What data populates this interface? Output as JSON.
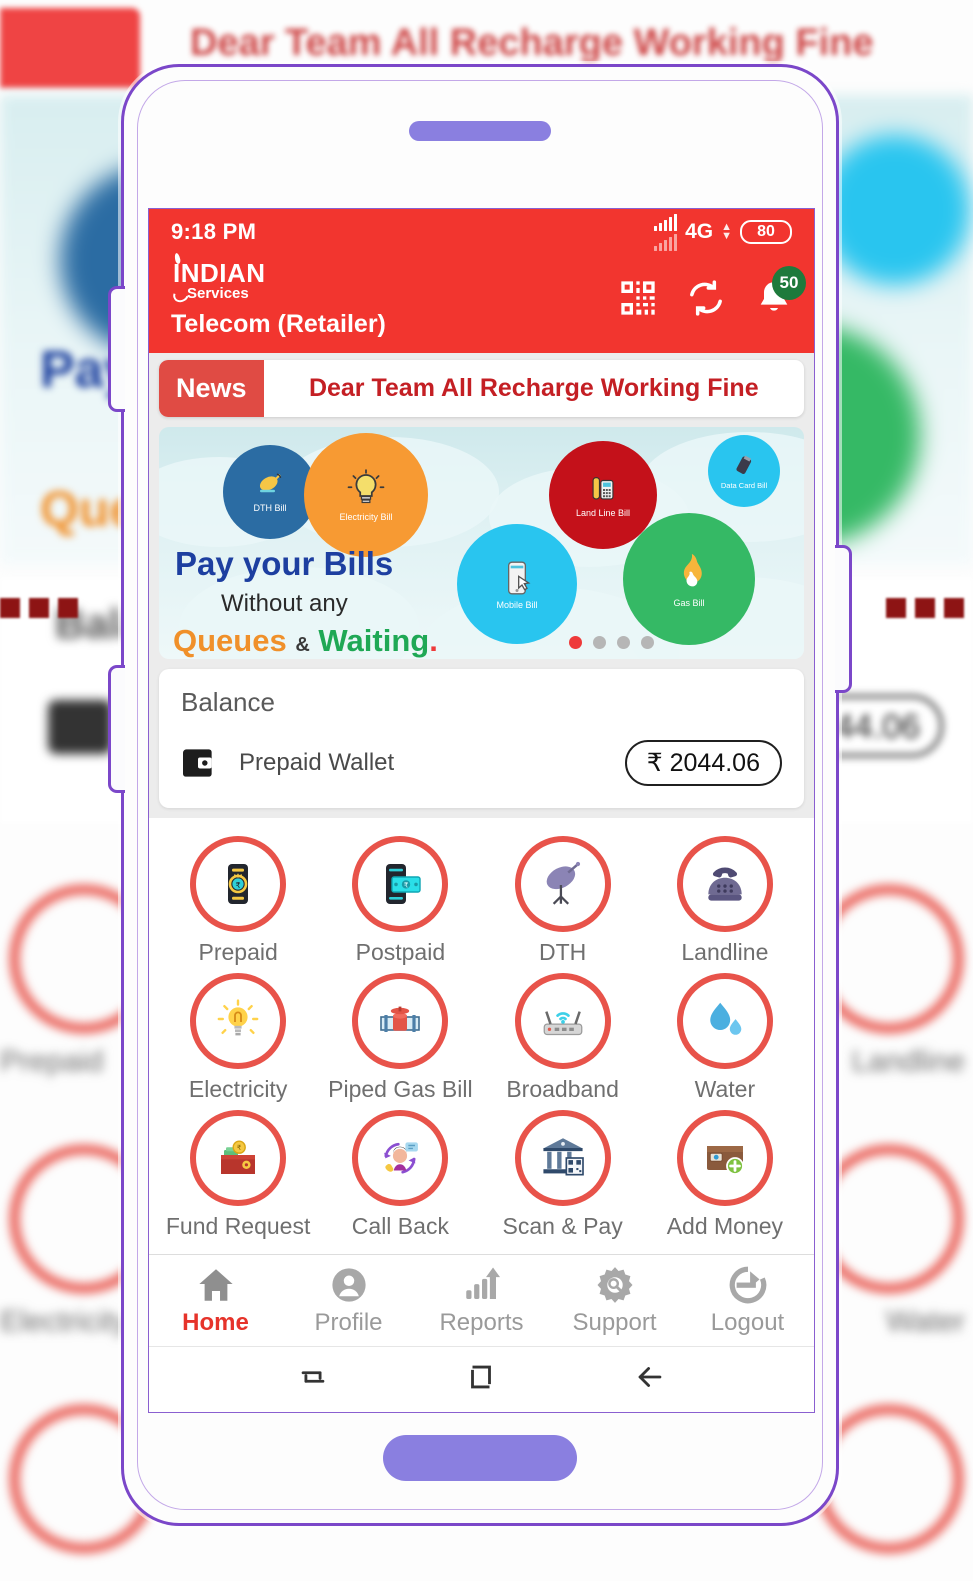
{
  "status_bar": {
    "time": "9:18 PM",
    "network": "4G",
    "battery": "80",
    "signal_icon": "signal-bars-icon",
    "updown_icon": "data-transfer-icon"
  },
  "app_bar": {
    "logo_line1": "INDIAN",
    "logo_line2": "Services",
    "title": "Telecom (Retailer)",
    "qr_icon": "qr-scanner-icon",
    "refresh_icon": "refresh-icon",
    "bell_icon": "notification-bell-icon",
    "notification_count": "50"
  },
  "news": {
    "badge": "News",
    "message": "Dear Team All Recharge Working Fine"
  },
  "banner": {
    "heading": "Pay your Bills",
    "sub1": "Without any",
    "sub2_a": "Queues",
    "sub2_amp": "&",
    "sub2_b": "Waiting",
    "bubbles": [
      {
        "label": "DTH Bill",
        "color": "#2b6ca3",
        "icon": "satellite-dish-icon"
      },
      {
        "label": "Electricity Bill",
        "color": "#f79a33",
        "icon": "light-bulb-icon"
      },
      {
        "label": "Land Line Bill",
        "color": "#c4111a",
        "icon": "landline-phone-icon"
      },
      {
        "label": "Data Card Bill",
        "color": "#29c5ef",
        "icon": "usb-dongle-icon"
      },
      {
        "label": "Mobile Bill",
        "color": "#29c5ef",
        "icon": "smartphone-tap-icon"
      },
      {
        "label": "Gas Bill",
        "color": "#35b965",
        "icon": "gas-flame-icon"
      }
    ],
    "dots": 4,
    "active_dot": 0
  },
  "balance": {
    "title": "Balance",
    "wallet_icon": "wallet-icon",
    "wallet_name": "Prepaid Wallet",
    "amount": "₹ 2044.06"
  },
  "services": [
    {
      "label": "Prepaid",
      "icon": "mobile-recharge-icon"
    },
    {
      "label": "Postpaid",
      "icon": "mobile-cash-icon"
    },
    {
      "label": "DTH",
      "icon": "satellite-dish-icon"
    },
    {
      "label": "Landline",
      "icon": "rotary-phone-icon"
    },
    {
      "label": "Electricity",
      "icon": "light-bulb-icon"
    },
    {
      "label": "Piped Gas Bill",
      "icon": "gas-pipe-icon"
    },
    {
      "label": "Broadband",
      "icon": "wifi-router-icon"
    },
    {
      "label": "Water",
      "icon": "water-drop-icon"
    },
    {
      "label": "Fund Request",
      "icon": "money-wallet-icon"
    },
    {
      "label": "Call Back",
      "icon": "callback-support-icon"
    },
    {
      "label": "Scan & Pay",
      "icon": "bank-qr-icon"
    },
    {
      "label": "Add Money",
      "icon": "add-money-wallet-icon"
    }
  ],
  "bottom_nav": [
    {
      "label": "Home",
      "icon": "home-icon",
      "active": true
    },
    {
      "label": "Profile",
      "icon": "profile-icon",
      "active": false
    },
    {
      "label": "Reports",
      "icon": "reports-icon",
      "active": false
    },
    {
      "label": "Support",
      "icon": "support-gear-icon",
      "active": false
    },
    {
      "label": "Logout",
      "icon": "logout-icon",
      "active": false
    }
  ],
  "android_nav": [
    {
      "name": "recents-button",
      "glyph": "⇌"
    },
    {
      "name": "home-button",
      "glyph": "▢"
    },
    {
      "name": "back-button",
      "glyph": "←"
    }
  ],
  "colors": {
    "brand_red": "#f2352f",
    "news_red": "#c41f24",
    "ring_red": "#e8534a",
    "badge_green": "#1e7a3c",
    "frame_purple": "#7b47c9",
    "accent_purple": "#8a7fe0"
  }
}
